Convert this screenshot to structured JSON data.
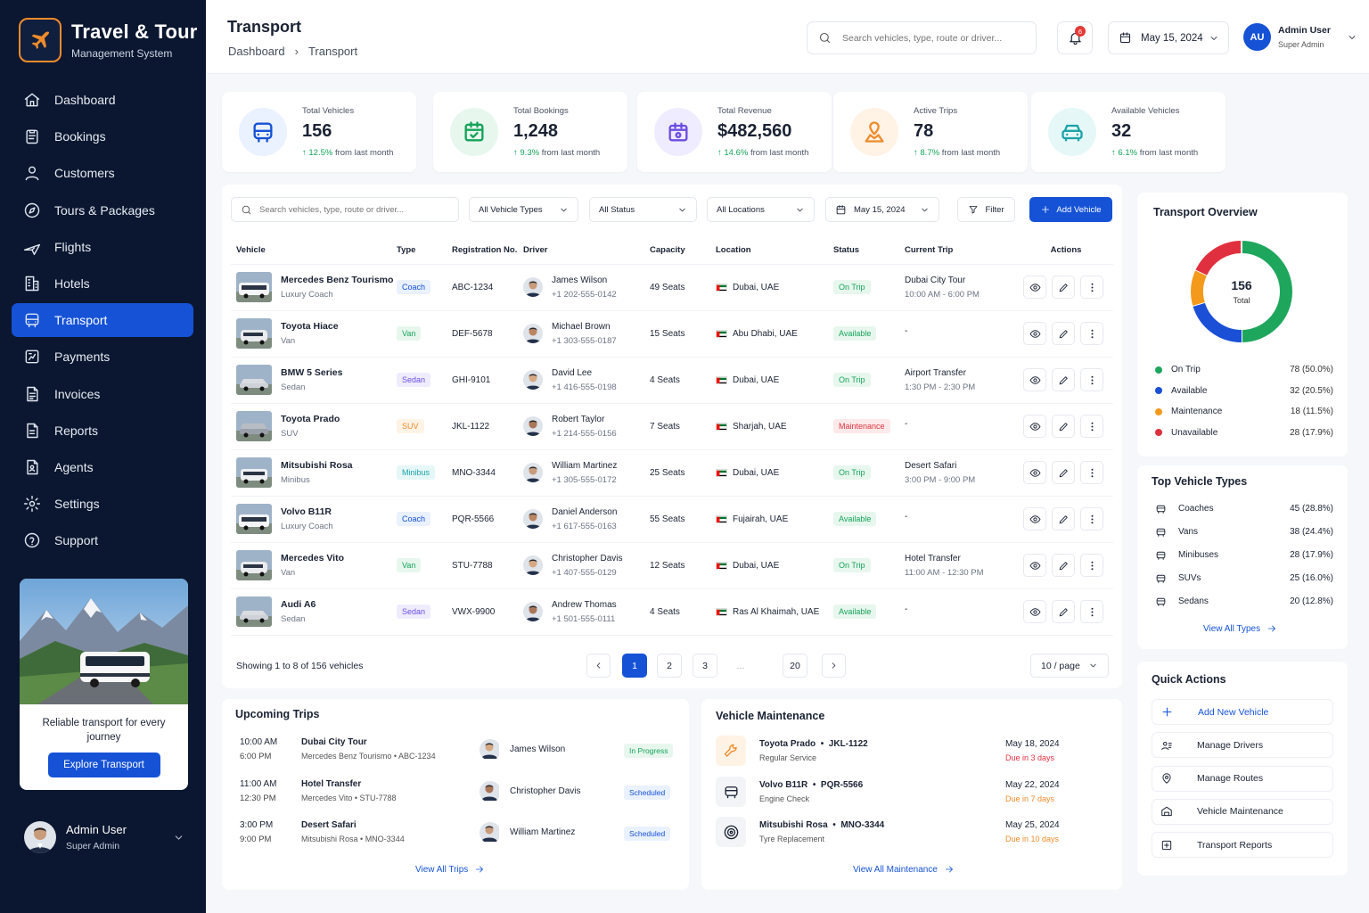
{
  "brand": {
    "title": "Travel & Tour",
    "subtitle": "Management System"
  },
  "nav": [
    {
      "label": "Dashboard",
      "icon": "home-icon"
    },
    {
      "label": "Bookings",
      "icon": "clipboard-icon"
    },
    {
      "label": "Customers",
      "icon": "user-icon"
    },
    {
      "label": "Tours & Packages",
      "icon": "compass-icon"
    },
    {
      "label": "Flights",
      "icon": "plane-icon"
    },
    {
      "label": "Hotels",
      "icon": "building-icon"
    },
    {
      "label": "Transport",
      "icon": "bus-icon",
      "active": true
    },
    {
      "label": "Payments",
      "icon": "receipt-icon"
    },
    {
      "label": "Invoices",
      "icon": "invoice-icon"
    },
    {
      "label": "Reports",
      "icon": "report-icon"
    },
    {
      "label": "Agents",
      "icon": "agent-icon"
    },
    {
      "label": "Settings",
      "icon": "gear-icon"
    },
    {
      "label": "Support",
      "icon": "help-icon"
    }
  ],
  "promo": {
    "text": "Reliable transport for every journey",
    "button": "Explore Transport"
  },
  "sidebar_user": {
    "name": "Admin User",
    "role": "Super Admin"
  },
  "header": {
    "title": "Transport",
    "breadcrumb": [
      "Dashboard",
      "Transport"
    ],
    "search_placeholder": "Search vehicles, type, route or driver...",
    "notifications": "6",
    "date": "May 15, 2024",
    "user_initials": "AU",
    "user_name": "Admin User",
    "user_role": "Super Admin"
  },
  "stats": [
    {
      "label": "Total Vehicles",
      "value": "156",
      "change": "12.5%",
      "suffix": "from last month",
      "icon": "bus-icon",
      "color": "#1552d6",
      "bg": "#eaf1ff"
    },
    {
      "label": "Total Bookings",
      "value": "1,248",
      "change": "9.3%",
      "suffix": "from last month",
      "icon": "calendar-check-icon",
      "color": "#15a35a",
      "bg": "#e8f7ee"
    },
    {
      "label": "Total Revenue",
      "value": "$482,560",
      "change": "14.6%",
      "suffix": "from last month",
      "icon": "wallet-icon",
      "color": "#6b4fe0",
      "bg": "#f0ecff"
    },
    {
      "label": "Active Trips",
      "value": "78",
      "change": "8.7%",
      "suffix": "from last month",
      "icon": "route-icon",
      "color": "#f08b2b",
      "bg": "#fff3e6"
    },
    {
      "label": "Available Vehicles",
      "value": "32",
      "change": "6.1%",
      "suffix": "from last month",
      "icon": "car-icon",
      "color": "#1aa3a8",
      "bg": "#e6f7f7"
    }
  ],
  "filters": {
    "search_placeholder": "Search vehicles, type, route or driver...",
    "types": "All Vehicle Types",
    "status": "All Status",
    "locations": "All Locations",
    "date": "May 15, 2024",
    "filter": "Filter",
    "add": "Add Vehicle"
  },
  "table": {
    "headers": [
      "Vehicle",
      "Type",
      "Registration No.",
      "Driver",
      "Capacity",
      "Location",
      "Status",
      "Current Trip",
      "Actions"
    ],
    "rows": [
      {
        "name": "Mercedes Benz Tourismo",
        "sub": "Luxury Coach",
        "type": "Coach",
        "reg": "ABC-1234",
        "driver": "James Wilson",
        "phone": "+1 202-555-0142",
        "capacity": "49 Seats",
        "location": "Dubai, UAE",
        "status": "On Trip",
        "trip": "Dubai City Tour",
        "trip_time": "10:00 AM - 6:00 PM"
      },
      {
        "name": "Toyota Hiace",
        "sub": "Van",
        "type": "Van",
        "reg": "DEF-5678",
        "driver": "Michael Brown",
        "phone": "+1 303-555-0187",
        "capacity": "15 Seats",
        "location": "Abu Dhabi, UAE",
        "status": "Available",
        "trip": "-",
        "trip_time": ""
      },
      {
        "name": "BMW 5 Series",
        "sub": "Sedan",
        "type": "Sedan",
        "reg": "GHI-9101",
        "driver": "David Lee",
        "phone": "+1 416-555-0198",
        "capacity": "4 Seats",
        "location": "Dubai, UAE",
        "status": "On Trip",
        "trip": "Airport Transfer",
        "trip_time": "1:30 PM - 2:30 PM"
      },
      {
        "name": "Toyota Prado",
        "sub": "SUV",
        "type": "SUV",
        "reg": "JKL-1122",
        "driver": "Robert Taylor",
        "phone": "+1 214-555-0156",
        "capacity": "7 Seats",
        "location": "Sharjah, UAE",
        "status": "Maintenance",
        "trip": "-",
        "trip_time": ""
      },
      {
        "name": "Mitsubishi Rosa",
        "sub": "Minibus",
        "type": "Minibus",
        "reg": "MNO-3344",
        "driver": "William Martinez",
        "phone": "+1 305-555-0172",
        "capacity": "25 Seats",
        "location": "Dubai, UAE",
        "status": "On Trip",
        "trip": "Desert Safari",
        "trip_time": "3:00 PM - 9:00 PM"
      },
      {
        "name": "Volvo B11R",
        "sub": "Luxury Coach",
        "type": "Coach",
        "reg": "PQR-5566",
        "driver": "Daniel Anderson",
        "phone": "+1 617-555-0163",
        "capacity": "55 Seats",
        "location": "Fujairah, UAE",
        "status": "Available",
        "trip": "-",
        "trip_time": ""
      },
      {
        "name": "Mercedes Vito",
        "sub": "Van",
        "type": "Van",
        "reg": "STU-7788",
        "driver": "Christopher Davis",
        "phone": "+1 407-555-0129",
        "capacity": "12 Seats",
        "location": "Dubai, UAE",
        "status": "On Trip",
        "trip": "Hotel Transfer",
        "trip_time": "11:00 AM - 12:30 PM"
      },
      {
        "name": "Audi A6",
        "sub": "Sedan",
        "type": "Sedan",
        "reg": "VWX-9900",
        "driver": "Andrew Thomas",
        "phone": "+1 501-555-0111",
        "capacity": "4 Seats",
        "location": "Ras Al Khaimah, UAE",
        "status": "Available",
        "trip": "-",
        "trip_time": ""
      }
    ],
    "showing": "Showing 1 to 8 of 156 vehicles",
    "pages": [
      "1",
      "2",
      "3",
      "...",
      "20"
    ],
    "per_page": "10 / page"
  },
  "type_colors": {
    "Coach": [
      "#eaf1ff",
      "#1552d6"
    ],
    "Van": [
      "#e8f7ee",
      "#15a35a"
    ],
    "Sedan": [
      "#f0ecff",
      "#6b4fe0"
    ],
    "SUV": [
      "#fff3e6",
      "#f08b2b"
    ],
    "Minibus": [
      "#e6f7f7",
      "#1aa3a8"
    ]
  },
  "status_colors": {
    "On Trip": [
      "#e8f7ee",
      "#15a35a"
    ],
    "Available": [
      "#e8f7ee",
      "#15a35a"
    ],
    "Maintenance": [
      "#fde9ea",
      "#d9343f"
    ]
  },
  "overview": {
    "title": "Transport Overview",
    "total": "156",
    "total_label": "Total",
    "items": [
      {
        "label": "On Trip",
        "value": "78 (50.0%)",
        "count": 78,
        "color": "#1ea65d"
      },
      {
        "label": "Available",
        "value": "32 (20.5%)",
        "count": 32,
        "color": "#1a4fd6"
      },
      {
        "label": "Maintenance",
        "value": "18 (11.5%)",
        "count": 18,
        "color": "#f39a1c"
      },
      {
        "label": "Unavailable",
        "value": "28 (17.9%)",
        "count": 28,
        "color": "#e0303f"
      }
    ]
  },
  "top_types": {
    "title": "Top Vehicle Types",
    "items": [
      {
        "label": "Coaches",
        "value": "45 (28.8%)"
      },
      {
        "label": "Vans",
        "value": "38 (24.4%)"
      },
      {
        "label": "Minibuses",
        "value": "28 (17.9%)"
      },
      {
        "label": "SUVs",
        "value": "25 (16.0%)"
      },
      {
        "label": "Sedans",
        "value": "20 (12.8%)"
      }
    ],
    "link": "View All Types"
  },
  "quick_actions": {
    "title": "Quick Actions",
    "items": [
      "Add New Vehicle",
      "Manage Drivers",
      "Manage Routes",
      "Vehicle Maintenance",
      "Transport Reports"
    ]
  },
  "upcoming": {
    "title": "Upcoming Trips",
    "items": [
      {
        "start": "10:00 AM",
        "end": "6:00 PM",
        "name": "Dubai City Tour",
        "vehicle": "Mercedes Benz Tourismo",
        "reg": "ABC-1234",
        "driver": "James Wilson",
        "status": "In Progress"
      },
      {
        "start": "11:00 AM",
        "end": "12:30 PM",
        "name": "Hotel Transfer",
        "vehicle": "Mercedes Vito",
        "reg": "STU-7788",
        "driver": "Christopher Davis",
        "status": "Scheduled"
      },
      {
        "start": "3:00 PM",
        "end": "9:00 PM",
        "name": "Desert Safari",
        "vehicle": "Mitsubishi Rosa",
        "reg": "MNO-3344",
        "driver": "William Martinez",
        "status": "Scheduled"
      }
    ],
    "link": "View All Trips"
  },
  "maintenance": {
    "title": "Vehicle Maintenance",
    "items": [
      {
        "vehicle": "Toyota Prado",
        "reg": "JKL-1122",
        "service": "Regular Service",
        "date": "May 18, 2024",
        "due": "Due in 3 days",
        "due_color": "#e0303f",
        "icon": "wrench-icon"
      },
      {
        "vehicle": "Volvo B11R",
        "reg": "PQR-5566",
        "service": "Engine Check",
        "date": "May 22, 2024",
        "due": "Due in 7 days",
        "due_color": "#f08b2b",
        "icon": "car-front-icon"
      },
      {
        "vehicle": "Mitsubishi Rosa",
        "reg": "MNO-3344",
        "service": "Tyre Replacement",
        "date": "May 25, 2024",
        "due": "Due in 10 days",
        "due_color": "#f08b2b",
        "icon": "tyre-icon"
      }
    ],
    "link": "View All Maintenance"
  }
}
